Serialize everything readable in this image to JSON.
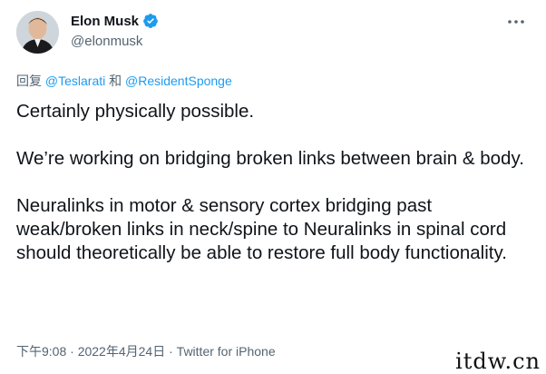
{
  "author": {
    "display_name": "Elon Musk",
    "handle": "@elonmusk",
    "verified_color": "#1d9bf0"
  },
  "reply": {
    "prefix": "回复",
    "mention_1": "@Teslarati",
    "joiner": "和",
    "mention_2": "@ResidentSponge"
  },
  "tweet": {
    "paragraph_1": "Certainly physically possible.",
    "paragraph_2": "We’re working on bridging broken links between brain & body.",
    "paragraph_3": "Neuralinks in motor & sensory cortex bridging past weak/broken links in neck/spine to Neuralinks in spinal cord should theoretically be able to restore full body functionality."
  },
  "meta": {
    "time": "下午9:08",
    "separator": "·",
    "date": "2022年4月24日",
    "source": "Twitter for iPhone"
  },
  "watermark": "itdw.cn",
  "icons": {
    "verified": "verified-badge-icon",
    "more": "more-dots-icon",
    "avatar": "avatar-photo"
  }
}
